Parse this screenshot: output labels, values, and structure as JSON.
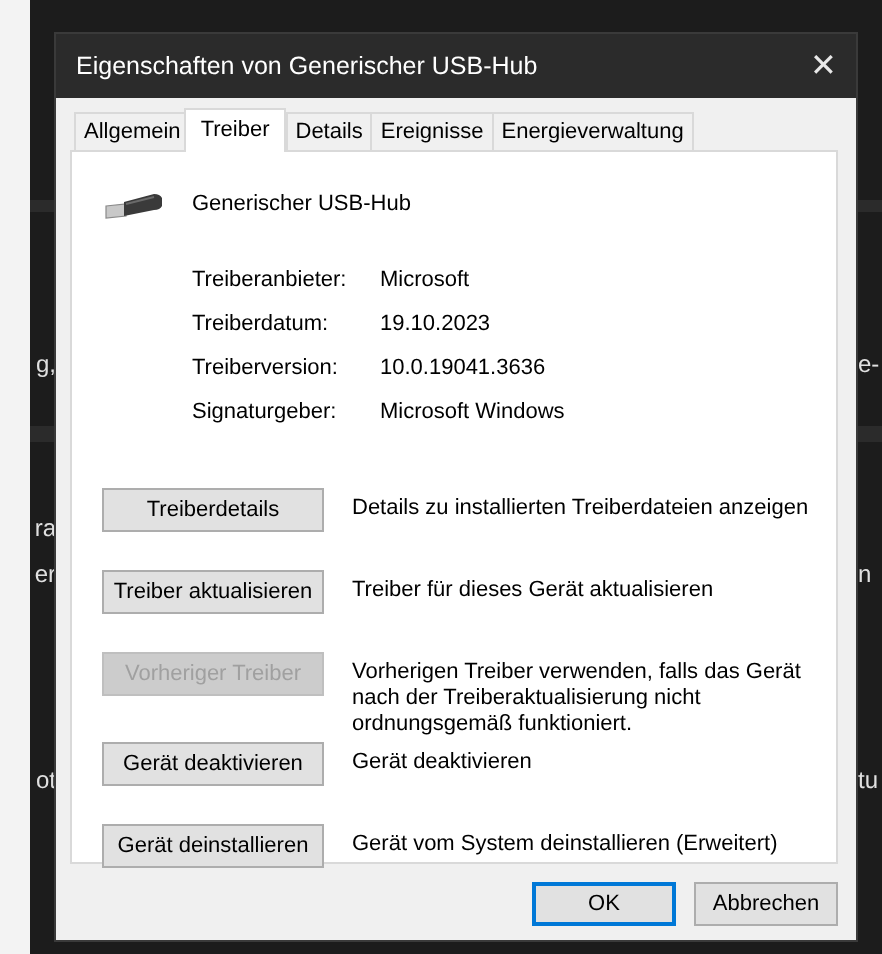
{
  "background": {
    "rows": [
      {
        "left": "g,",
        "right": "e-"
      },
      {
        "left": "ra"
      },
      {
        "left": "er",
        "right": "n"
      },
      {
        "left": "ot",
        "right": "tu"
      }
    ]
  },
  "window": {
    "title": "Eigenschaften von Generischer USB-Hub",
    "close": "✕"
  },
  "tabs": [
    {
      "label": "Allgemein",
      "selected": false
    },
    {
      "label": "Treiber",
      "selected": true
    },
    {
      "label": "Details",
      "selected": false
    },
    {
      "label": "Ereignisse",
      "selected": false
    },
    {
      "label": "Energieverwaltung",
      "selected": false
    }
  ],
  "device": {
    "name": "Generischer USB-Hub"
  },
  "properties": [
    {
      "label": "Treiberanbieter:",
      "value": "Microsoft"
    },
    {
      "label": "Treiberdatum:",
      "value": "19.10.2023"
    },
    {
      "label": "Treiberversion:",
      "value": "10.0.19041.3636"
    },
    {
      "label": "Signaturgeber:",
      "value": "Microsoft Windows"
    }
  ],
  "actions": [
    {
      "button": "Treiberdetails",
      "disabled": false,
      "description": "Details zu installierten Treiberdateien anzeigen"
    },
    {
      "button": "Treiber aktualisieren",
      "disabled": false,
      "description": "Treiber für dieses Gerät aktualisieren"
    },
    {
      "button": "Vorheriger Treiber",
      "disabled": true,
      "description": "Vorherigen Treiber verwenden, falls das Gerät nach der Treiberaktualisierung nicht ordnungsgemäß funktioniert."
    },
    {
      "button": "Gerät deaktivieren",
      "disabled": false,
      "description": "Gerät deaktivieren"
    },
    {
      "button": "Gerät deinstallieren",
      "disabled": false,
      "description": "Gerät vom System deinstallieren (Erweitert)"
    }
  ],
  "buttons": [
    {
      "label": "OK",
      "default": true
    },
    {
      "label": "Abbrechen",
      "default": false
    }
  ]
}
